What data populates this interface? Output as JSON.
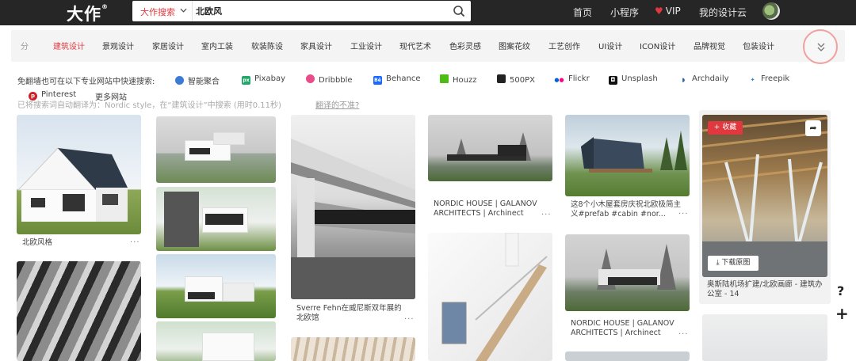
{
  "header": {
    "logo": "大作",
    "logo_mark": "®",
    "search_type": "大作搜索",
    "search_value": "北欧风",
    "nav": [
      "首页",
      "小程序",
      "VIP",
      "我的设计云"
    ]
  },
  "categories": {
    "items": [
      "分",
      "建筑设计",
      "景观设计",
      "家居设计",
      "室内工装",
      "软装陈设",
      "家具设计",
      "工业设计",
      "现代艺术",
      "色彩灵感",
      "图案花纹",
      "工艺创作",
      "UI设计",
      "ICON设计",
      "品牌视觉",
      "包装设计"
    ],
    "active": "建筑设计"
  },
  "quick_search": {
    "intro": "免翻墙也可在以下专业网站中快速搜索:",
    "sites": [
      "智能聚合",
      "Pixabay",
      "Dribbble",
      "Behance",
      "Houzz",
      "500PX",
      "Flickr",
      "Unsplash",
      "Archdaily",
      "Freepik",
      "Pinterest",
      "更多网站"
    ],
    "translate_note": "已将搜索词自动翻译为：Nordic style，在“建筑设计”中搜索 (用时0.11秒)",
    "translate_link": "翻译的不准?"
  },
  "cards": {
    "c1": "北欧风格",
    "c5": "Sverre Fehn在威尼斯双年展的北欧馆",
    "c6": "NORDIC HOUSE | GALANOV ARCHITECTS | Archinect",
    "c8": "这8个小木屋套房庆祝北欧极简主义#prefab #cabin #nor...",
    "c9": "NORDIC HOUSE | GALANOV ARCHITECTS | Archinect",
    "c10": "奥斯陆机场扩建/北欧画廊 - 建筑办公室 - 14",
    "more": "···"
  },
  "actions": {
    "favorite": "+ 收藏",
    "download": "下载原图"
  },
  "side": {
    "help": "?",
    "add": "+"
  }
}
